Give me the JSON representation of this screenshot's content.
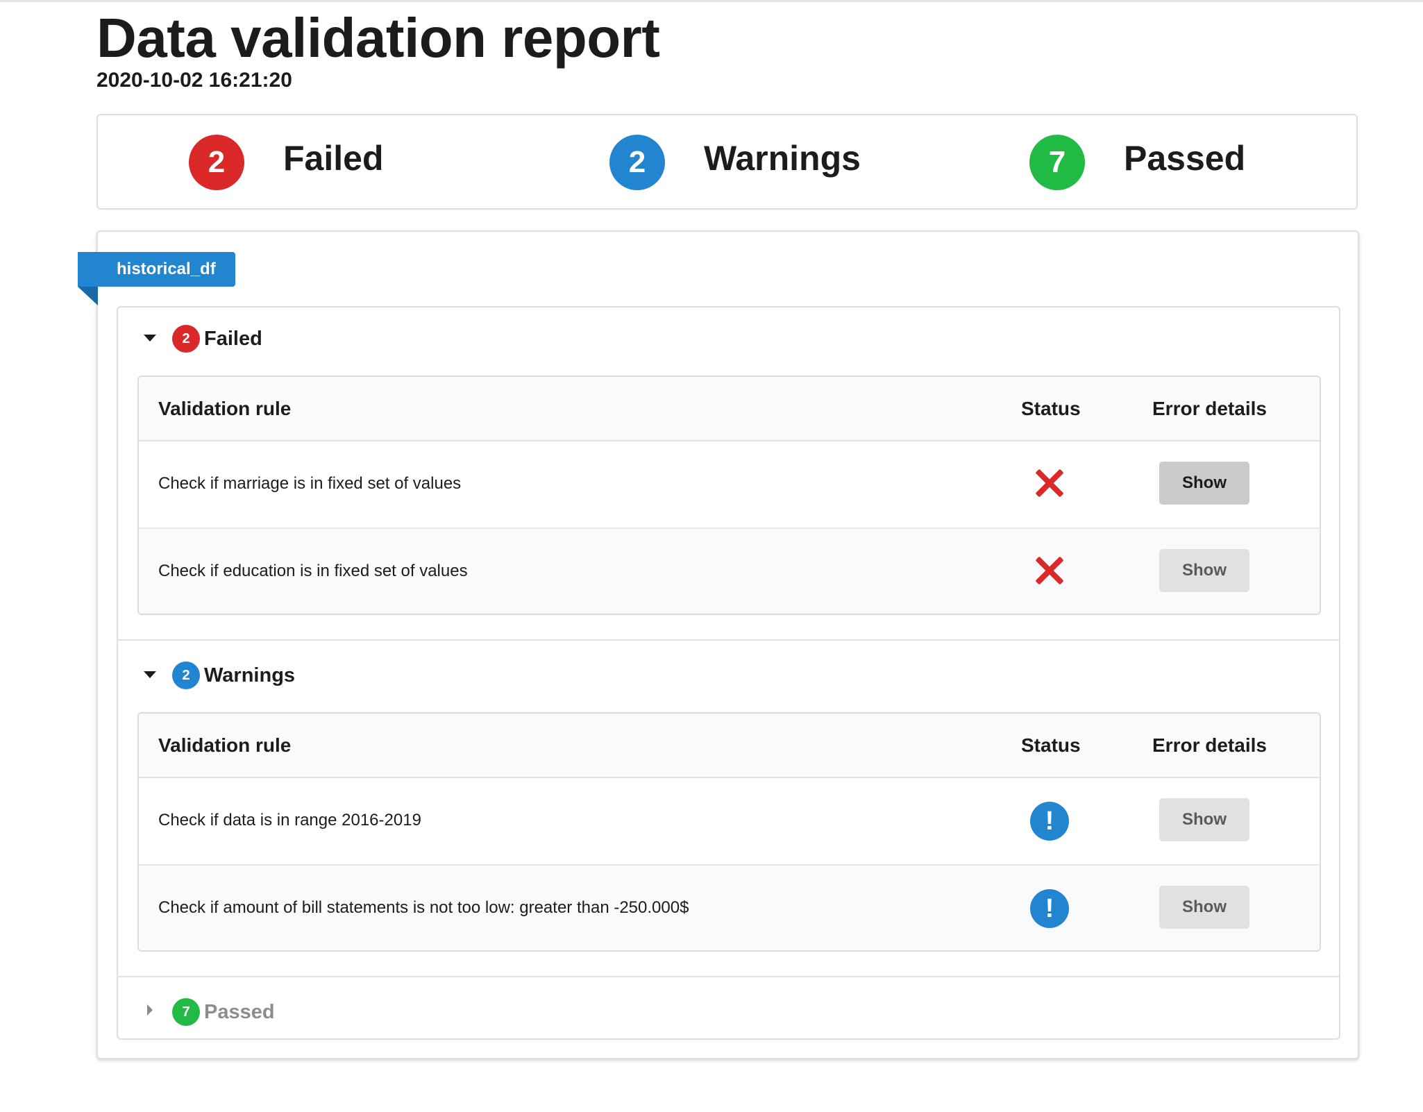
{
  "title": "Data validation report",
  "timestamp": "2020-10-02 16:21:20",
  "colors": {
    "failed": "#db2828",
    "warning": "#2185d0",
    "passed": "#21ba45"
  },
  "summary": {
    "failed": {
      "count": "2",
      "label": "Failed"
    },
    "warnings": {
      "count": "2",
      "label": "Warnings"
    },
    "passed": {
      "count": "7",
      "label": "Passed"
    }
  },
  "dataset": {
    "name": "historical_df",
    "sections": {
      "failed": {
        "count": "2",
        "label": "Failed",
        "expanded": true,
        "columns": {
          "rule": "Validation rule",
          "status": "Status",
          "details": "Error details"
        },
        "rows": [
          {
            "rule": "Check if marriage is in fixed set of values",
            "status": "x-icon",
            "button": "Show"
          },
          {
            "rule": "Check if education is in fixed set of values",
            "status": "x-icon",
            "button": "Show"
          }
        ]
      },
      "warnings": {
        "count": "2",
        "label": "Warnings",
        "expanded": true,
        "columns": {
          "rule": "Validation rule",
          "status": "Status",
          "details": "Error details"
        },
        "rows": [
          {
            "rule": "Check if data is in range 2016-2019",
            "status": "exclamation-icon",
            "button": "Show",
            "icon_glyph": "!"
          },
          {
            "rule": "Check if amount of bill statements is not too low: greater than -250.000$",
            "status": "exclamation-icon",
            "button": "Show",
            "icon_glyph": "!"
          }
        ]
      },
      "passed": {
        "count": "7",
        "label": "Passed",
        "expanded": false
      }
    }
  }
}
